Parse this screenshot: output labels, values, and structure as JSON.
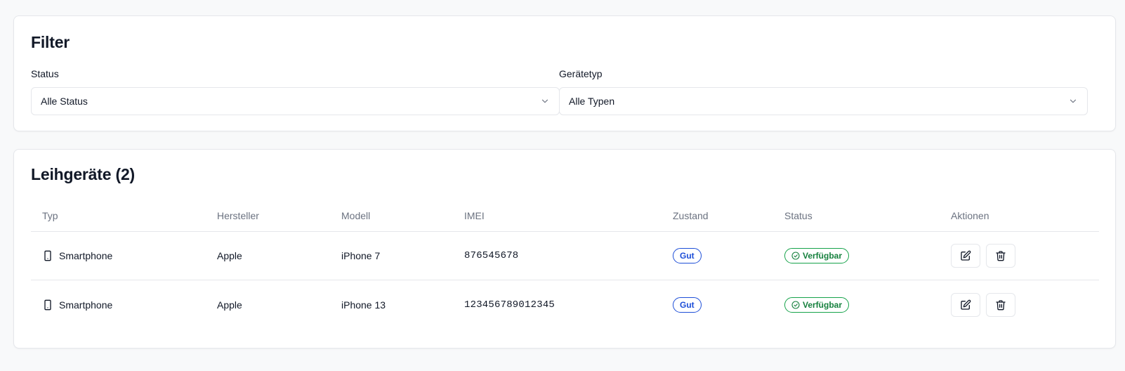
{
  "filter": {
    "title": "Filter",
    "status_label": "Status",
    "status_value": "Alle Status",
    "type_label": "Gerätetyp",
    "type_value": "Alle Typen"
  },
  "devices": {
    "title": "Leihgeräte (2)",
    "columns": [
      "Typ",
      "Hersteller",
      "Modell",
      "IMEI",
      "Zustand",
      "Status",
      "Aktionen"
    ],
    "rows": [
      {
        "type": "Smartphone",
        "manufacturer": "Apple",
        "model": "iPhone 7",
        "imei": "876545678",
        "condition": "Gut",
        "status": "Verfügbar"
      },
      {
        "type": "Smartphone",
        "manufacturer": "Apple",
        "model": "iPhone 13",
        "imei": "123456789012345",
        "condition": "Gut",
        "status": "Verfügbar"
      }
    ]
  },
  "colors": {
    "condition_badge": "#1d4ed8",
    "status_badge": "#15803d",
    "background": "#f8f9fa"
  },
  "icons": {
    "select_chevron": "chevron-down-icon",
    "device_type": "smartphone-icon",
    "status": "check-circle-icon",
    "edit_action": "edit-icon",
    "delete_action": "trash-icon"
  }
}
